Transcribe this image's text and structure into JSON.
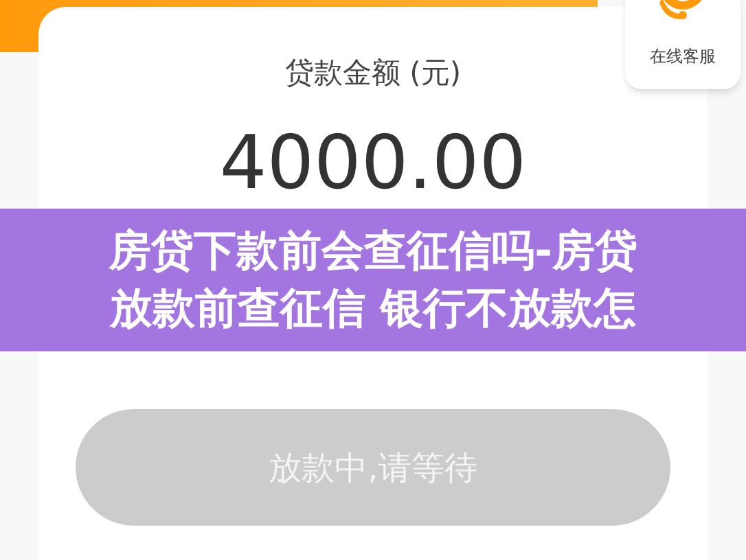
{
  "loan_card": {
    "label": "贷款金额 (元)",
    "amount": "4000.00"
  },
  "customer_service": {
    "label": "在线客服"
  },
  "banner": {
    "lines": [
      "房贷下款前会查征信吗-房贷",
      "放款前查征信 银行不放款怎"
    ]
  },
  "status_button": {
    "label": "放款中,请等待",
    "disabled": true
  }
}
